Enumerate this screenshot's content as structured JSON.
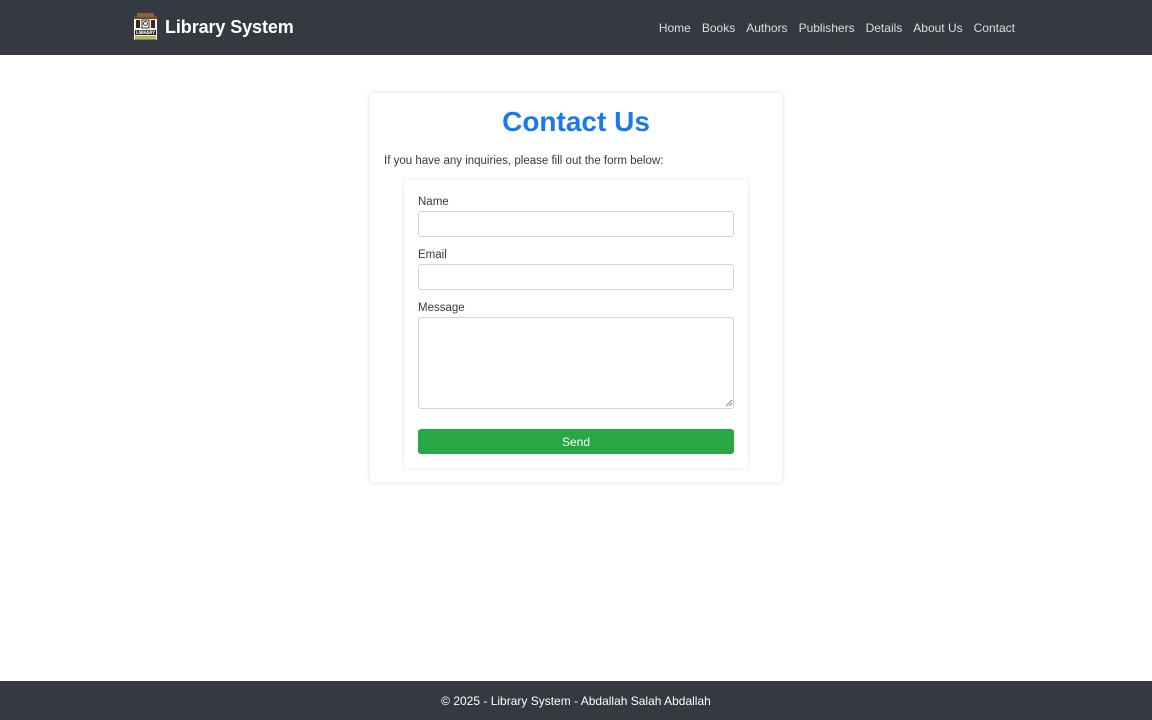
{
  "navbar": {
    "brand": "Library System",
    "logo_text": "LIBRARY",
    "links": [
      "Home",
      "Books",
      "Authors",
      "Publishers",
      "Details",
      "About Us",
      "Contact"
    ]
  },
  "contact": {
    "title": "Contact Us",
    "intro": "If you have any inquiries, please fill out the form below:",
    "name_label": "Name",
    "name_value": "",
    "email_label": "Email",
    "email_value": "",
    "message_label": "Message",
    "message_value": "",
    "send_label": "Send"
  },
  "footer": {
    "text": "© 2025 - Library System - Abdallah Salah Abdallah"
  },
  "colors": {
    "navbar_bg": "#343a40",
    "title": "#1a7be8",
    "send_button": "#28a745"
  }
}
